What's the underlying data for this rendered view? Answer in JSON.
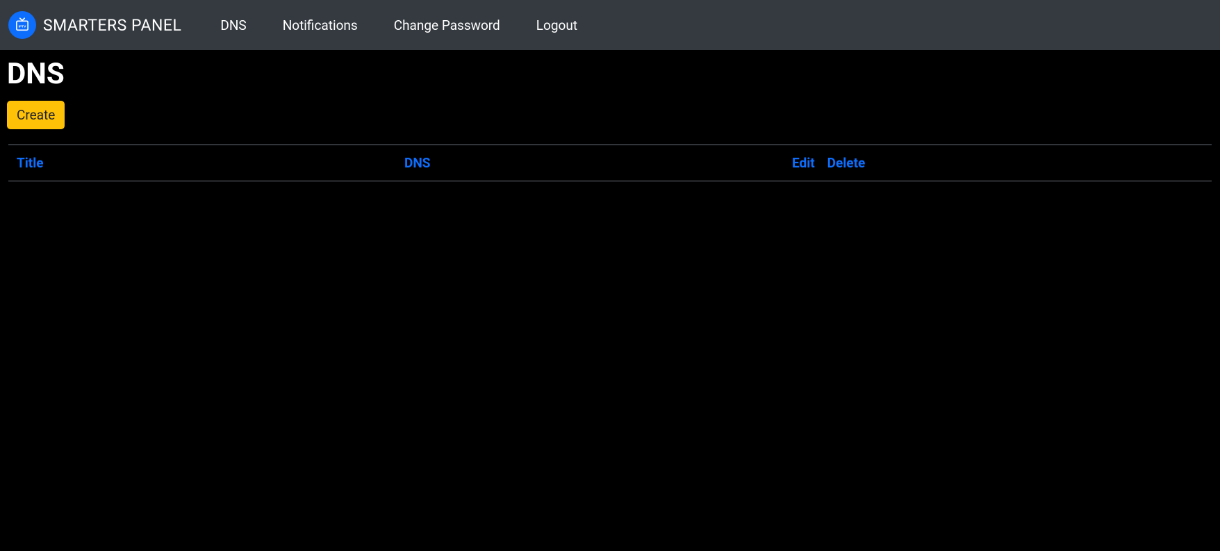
{
  "brand": {
    "name": "SMARTERS PANEL",
    "iconLabel": "IPTV"
  },
  "nav": {
    "items": [
      {
        "label": "DNS"
      },
      {
        "label": "Notifications"
      },
      {
        "label": "Change Password"
      },
      {
        "label": "Logout"
      }
    ]
  },
  "page": {
    "title": "DNS",
    "createLabel": "Create"
  },
  "table": {
    "columns": {
      "title": "Title",
      "dns": "DNS",
      "edit": "Edit",
      "delete": "Delete"
    },
    "rows": []
  }
}
